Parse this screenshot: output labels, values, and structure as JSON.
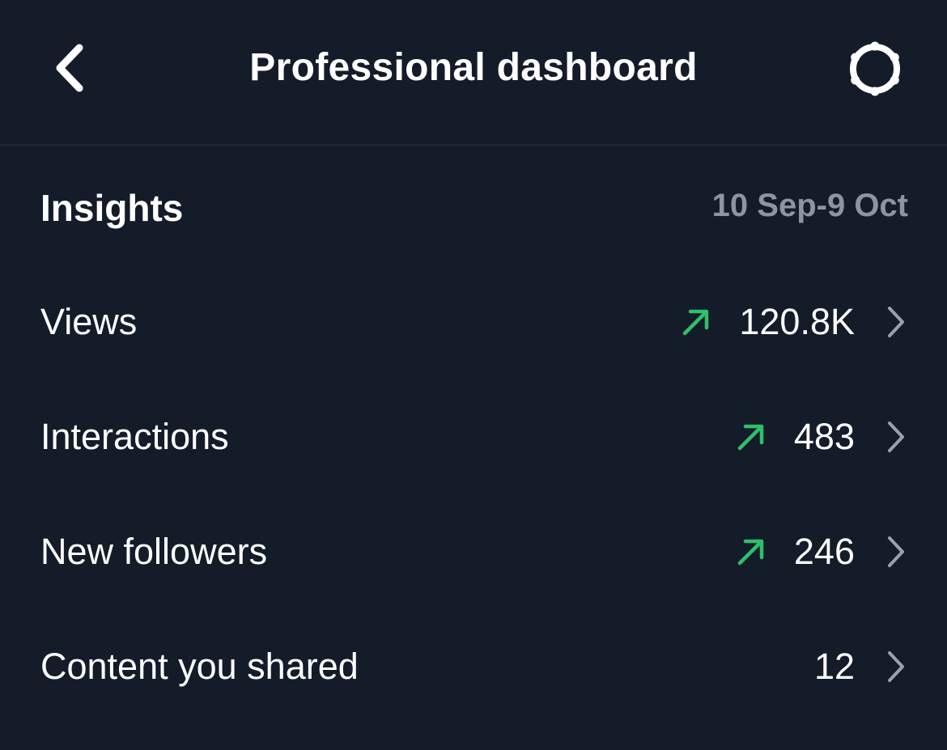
{
  "header": {
    "title": "Professional dashboard",
    "back_icon": "chevron-left-icon",
    "settings_icon": "gear-icon"
  },
  "insights": {
    "title": "Insights",
    "date_range": "10 Sep-9 Oct"
  },
  "metrics": [
    {
      "label": "Views",
      "value": "120.8K",
      "trend": "up"
    },
    {
      "label": "Interactions",
      "value": "483",
      "trend": "up"
    },
    {
      "label": "New followers",
      "value": "246",
      "trend": "up"
    },
    {
      "label": "Content you shared",
      "value": "12",
      "trend": "none"
    }
  ],
  "colors": {
    "background": "#141c2a",
    "text": "#ffffff",
    "muted": "#8c95a3",
    "trend_up": "#2fc06a",
    "chevron": "#9aa1ad"
  }
}
